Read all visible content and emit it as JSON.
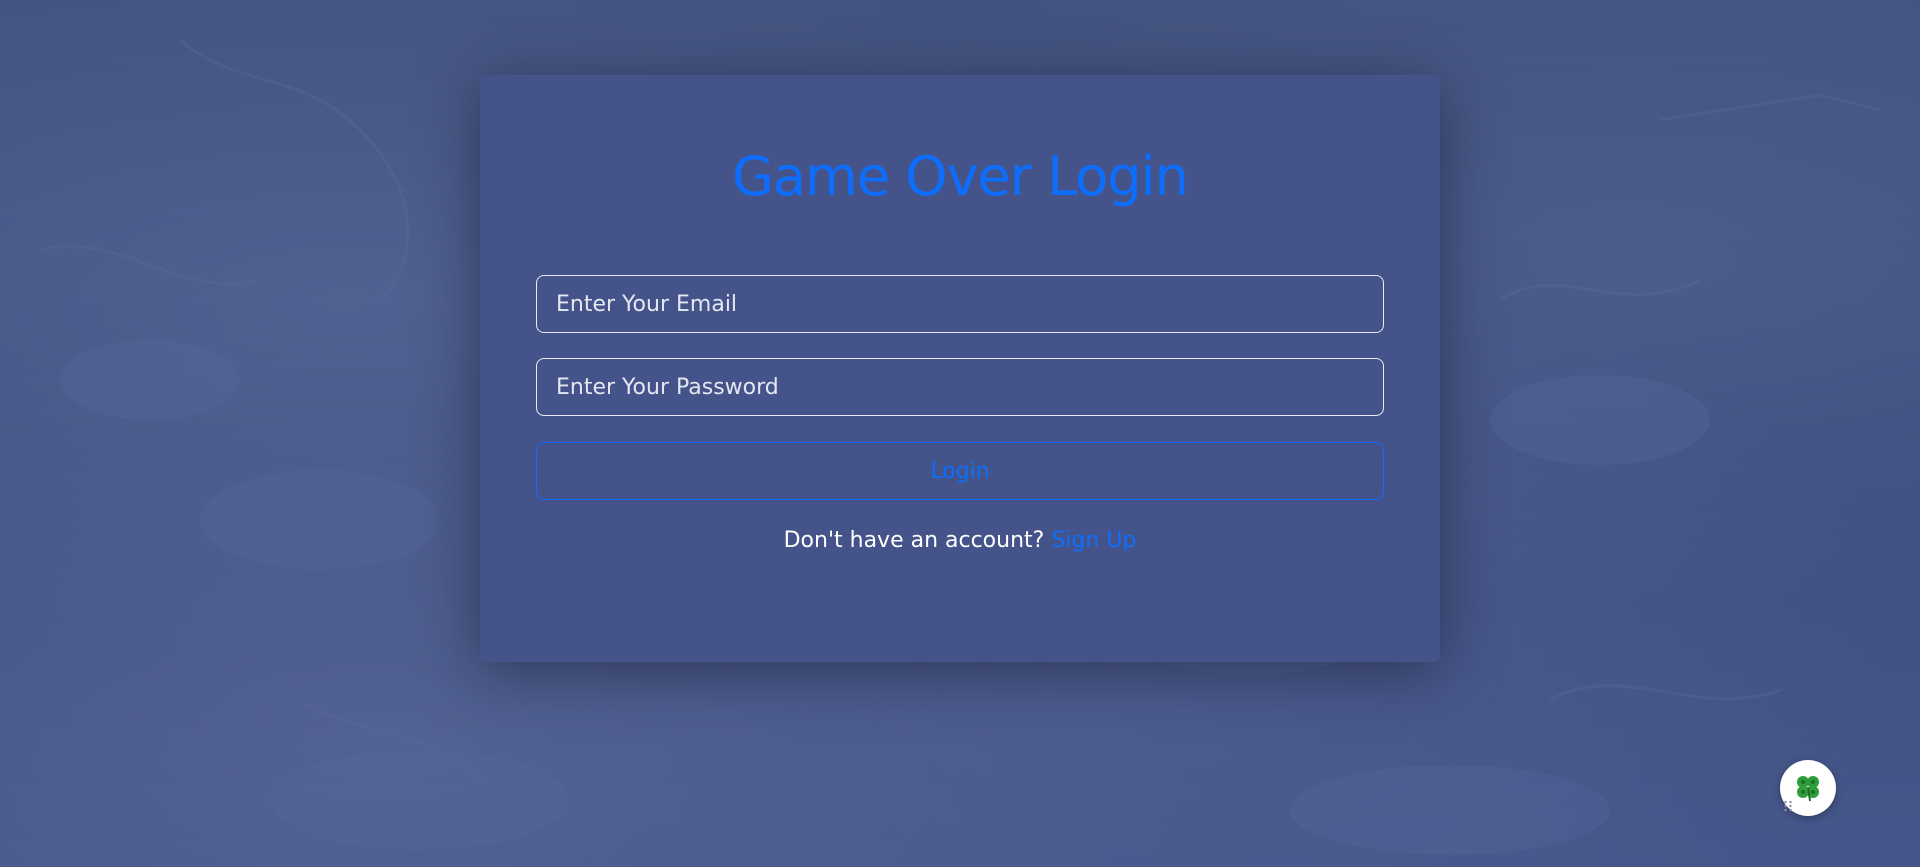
{
  "page": {
    "title": "Game Over Login"
  },
  "form": {
    "email_placeholder": "Enter Your Email",
    "email_value": "",
    "password_placeholder": "Enter Your Password",
    "password_value": "",
    "login_label": "Login"
  },
  "signup": {
    "prompt": "Don't have an account?",
    "link_label": "Sign Up"
  },
  "widget": {
    "icon": "clover-icon",
    "grip_icon": "drag-handle-icon"
  },
  "colors": {
    "accent": "#0d6efd",
    "background": "#3f4f7f",
    "card": "#44548a",
    "text": "#ffffff"
  }
}
